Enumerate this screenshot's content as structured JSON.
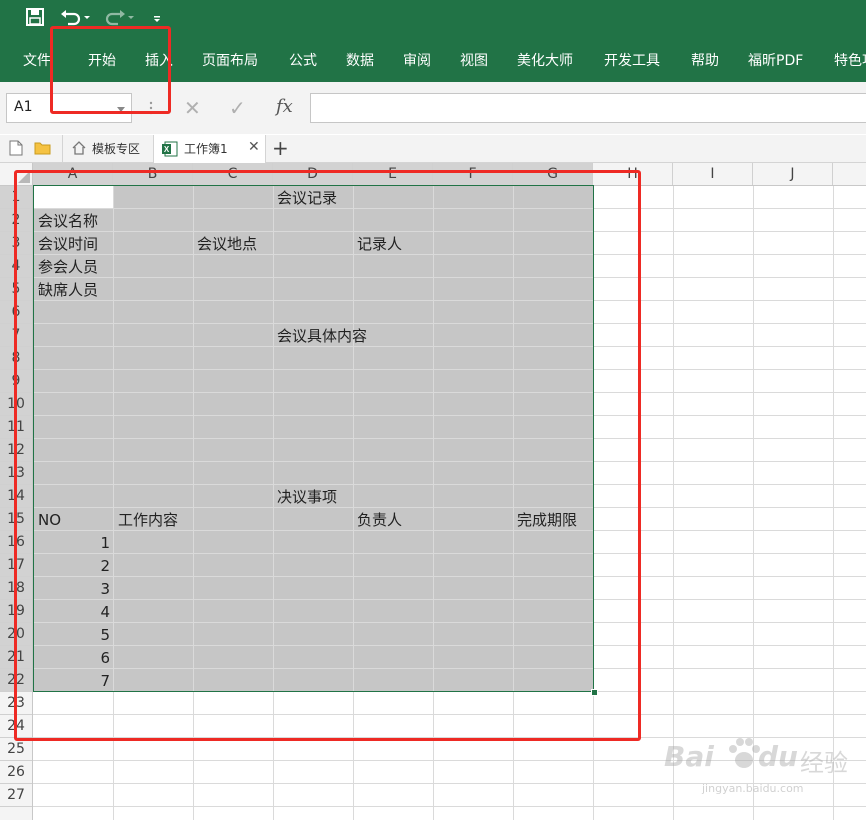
{
  "colors": {
    "ribbon": "#217346",
    "selection": "#c6c6c6",
    "highlight": "#ee2a24",
    "tab_active_bg": "#ffffff"
  },
  "quick_access": {
    "save_icon": "save-icon",
    "undo_icon": "undo-icon",
    "redo_icon": "redo-icon",
    "customize_icon": "customize-icon"
  },
  "menu": [
    "文件",
    "开始",
    "插入",
    "页面布局",
    "公式",
    "数据",
    "审阅",
    "视图",
    "美化大师",
    "开发工具",
    "帮助",
    "福昕PDF",
    "特色功"
  ],
  "namebox": {
    "value": "A1"
  },
  "formula": {
    "cancel": "✕",
    "enter": "✓",
    "fx": "fx",
    "value": ""
  },
  "tabs": [
    {
      "label": "模板专区"
    },
    {
      "label": "工作簿1"
    }
  ],
  "columns": [
    "A",
    "B",
    "C",
    "D",
    "E",
    "F",
    "G",
    "H",
    "I",
    "J"
  ],
  "rows": [
    "1",
    "2",
    "3",
    "4",
    "5",
    "6",
    "7",
    "8",
    "9",
    "10",
    "11",
    "12",
    "13",
    "14",
    "15",
    "16",
    "17",
    "18",
    "19",
    "20",
    "21",
    "22",
    "23",
    "24",
    "25",
    "26",
    "27"
  ],
  "cells": {
    "D1": "会议记录",
    "A2": "会议名称",
    "A3": "会议时间",
    "C3": "会议地点",
    "E3": "记录人",
    "A4": "参会人员",
    "A5": "缺席人员",
    "D7": "会议具体内容",
    "D14": "决议事项",
    "A15": "NO",
    "B15": "工作内容",
    "E15": "负责人",
    "G15": "完成期限",
    "A16": "1",
    "A17": "2",
    "A18": "3",
    "A19": "4",
    "A20": "5",
    "A21": "6",
    "A22": "7"
  },
  "watermark": {
    "brand": "Bai",
    "brand2": "du",
    "cn": "经验",
    "url": "jingyan.baidu.com"
  }
}
